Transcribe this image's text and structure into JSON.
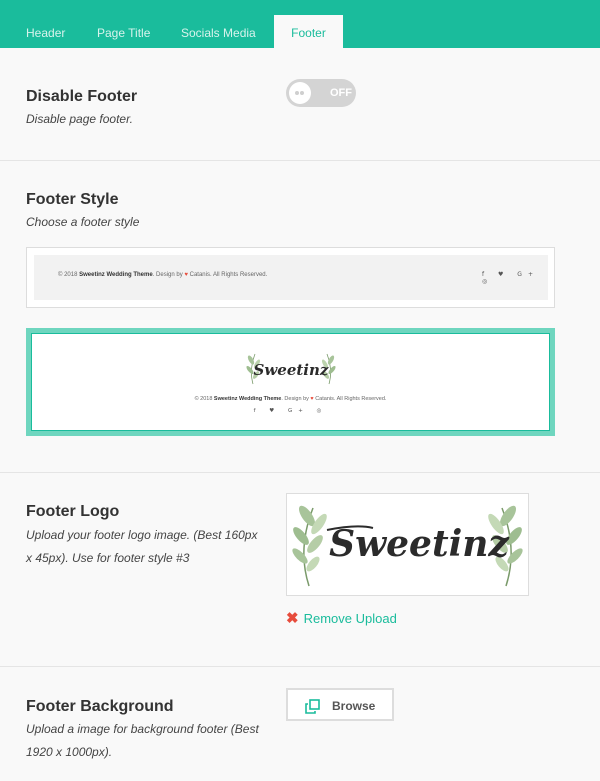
{
  "tabs": [
    {
      "label": "Header"
    },
    {
      "label": "Page Title"
    },
    {
      "label": "Socials Media"
    },
    {
      "label": "Footer"
    }
  ],
  "disable_footer": {
    "title": "Disable Footer",
    "description": "Disable page footer.",
    "toggle_label": "OFF",
    "toggle_state": "off"
  },
  "footer_style": {
    "title": "Footer Style",
    "description": "Choose a footer style",
    "preview": {
      "copyright_prefix": "© 2018",
      "brand": "Sweetinz Wedding Theme",
      "design_by": ". Design by",
      "heart": "♥",
      "author": "Catanis. All Rights Reserved.",
      "socials": "f ♥ G+ ◎",
      "logo_text": "Sweetinz"
    },
    "selected": "style-3"
  },
  "footer_logo": {
    "title": "Footer Logo",
    "description_line1": "Upload your footer logo image. (Best 160px",
    "description_line2": "x 45px). Use for footer style #3",
    "logo_text": "Sweetinz",
    "remove_icon": "✖",
    "remove_label": "Remove Upload"
  },
  "footer_background": {
    "title": "Footer Background",
    "description_line1": "Upload a image for background footer (Best",
    "description_line2": "1920 x 1000px).",
    "browse_label": "Browse"
  },
  "colors": {
    "accent": "#1abc9c",
    "remove": "#e74c3c"
  }
}
